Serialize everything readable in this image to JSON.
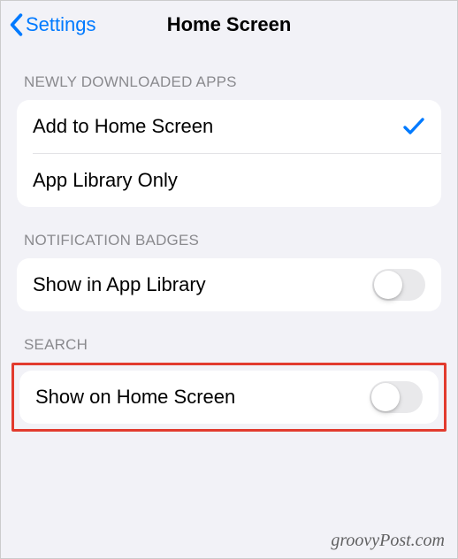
{
  "nav": {
    "back_label": "Settings",
    "title": "Home Screen"
  },
  "sections": {
    "newly_downloaded": {
      "header": "NEWLY DOWNLOADED APPS",
      "options": {
        "add_home": {
          "label": "Add to Home Screen",
          "selected": true
        },
        "app_library_only": {
          "label": "App Library Only",
          "selected": false
        }
      }
    },
    "notification_badges": {
      "header": "NOTIFICATION BADGES",
      "show_in_app_library": {
        "label": "Show in App Library",
        "enabled": false
      }
    },
    "search": {
      "header": "SEARCH",
      "show_on_home": {
        "label": "Show on Home Screen",
        "enabled": false,
        "highlighted": true
      }
    }
  },
  "colors": {
    "accent": "#007aff",
    "highlight_border": "#e23b2e",
    "section_header": "#8a8a8e",
    "background": "#f2f2f7"
  },
  "watermark": "groovyPost.com"
}
